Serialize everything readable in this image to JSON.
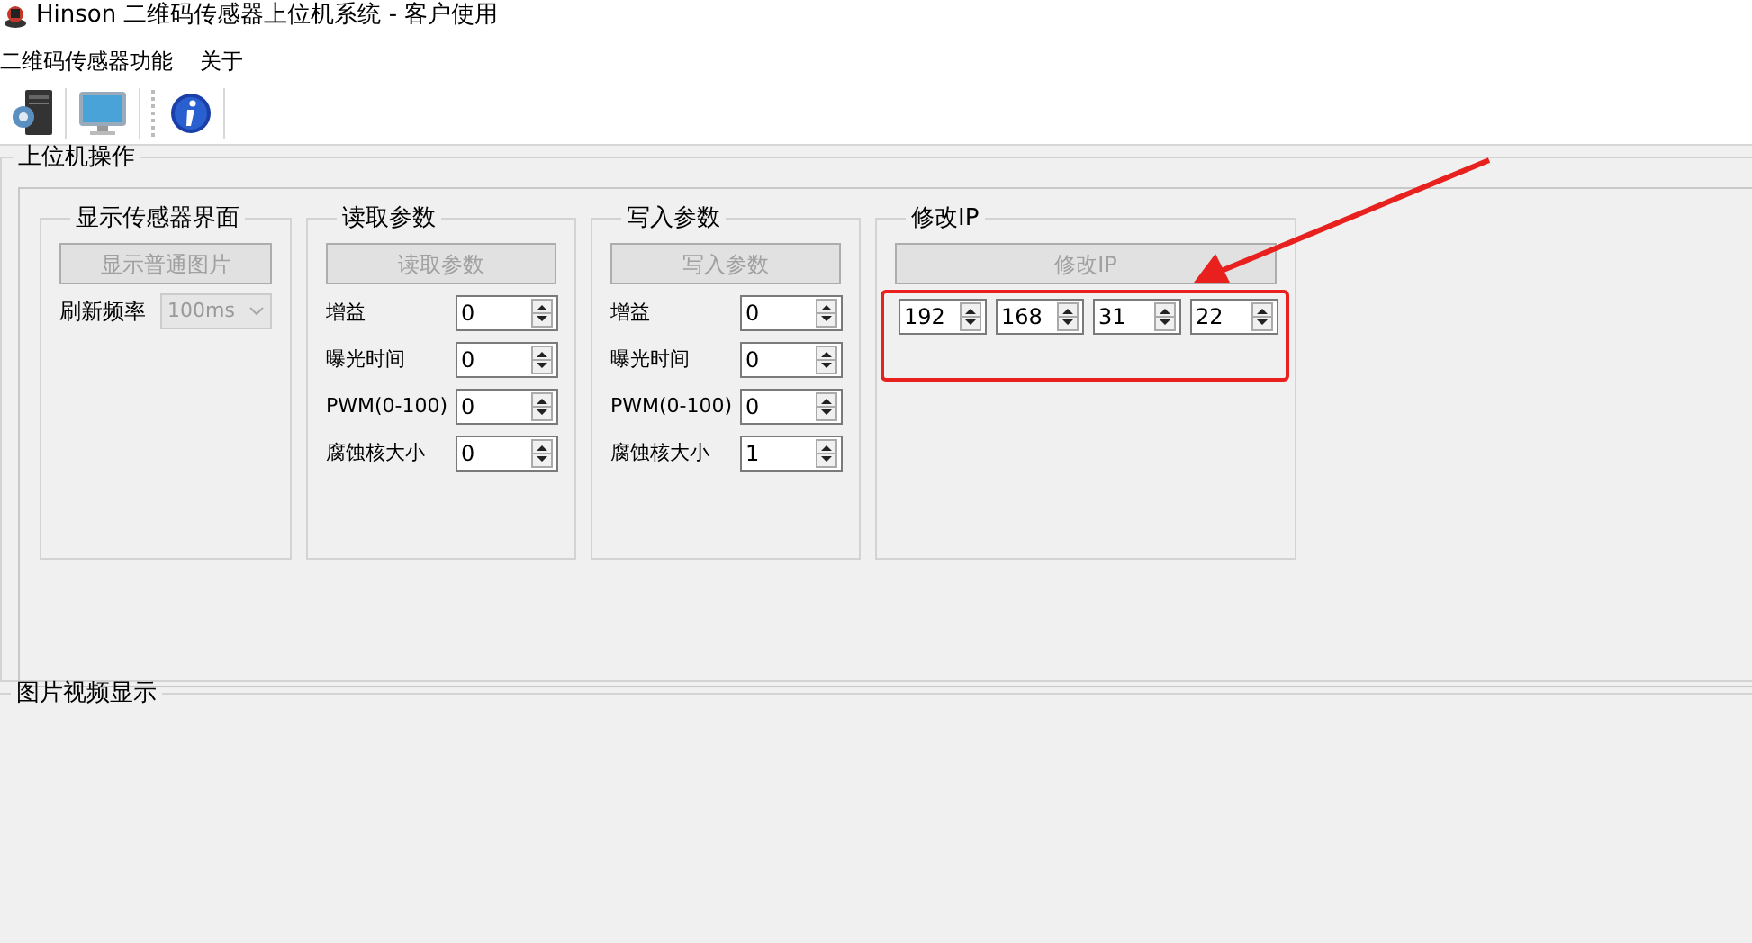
{
  "window": {
    "title": "Hinson 二维码传感器上位机系统 - 客户使用"
  },
  "menu": [
    {
      "label": "二维码传感器功能"
    },
    {
      "label": "关于"
    }
  ],
  "toolbar": [
    {
      "kind": "computer"
    },
    {
      "kind": "monitor"
    },
    {
      "kind": "info"
    }
  ],
  "operation_panel": {
    "title": "上位机操作",
    "groups": [
      {
        "kind": "display",
        "title": "显示传感器界面",
        "button": {
          "label": "显示普通图片",
          "disabled": true
        },
        "refresh": {
          "label": "刷新频率",
          "value": "100ms",
          "disabled": true
        }
      },
      {
        "kind": "params",
        "title": "读取参数",
        "button": {
          "label": "读取参数",
          "disabled": true
        },
        "fields": [
          {
            "label": "增益",
            "value": "0"
          },
          {
            "label": "曝光时间",
            "value": "0"
          },
          {
            "label": "PWM(0-100)",
            "value": "0"
          },
          {
            "label": "腐蚀核大小",
            "value": "0"
          }
        ]
      },
      {
        "kind": "params",
        "title": "写入参数",
        "button": {
          "label": "写入参数",
          "disabled": true
        },
        "fields": [
          {
            "label": "增益",
            "value": "0"
          },
          {
            "label": "曝光时间",
            "value": "0"
          },
          {
            "label": "PWM(0-100)",
            "value": "0"
          },
          {
            "label": "腐蚀核大小",
            "value": "1"
          }
        ]
      },
      {
        "kind": "ip",
        "title": "修改IP",
        "button": {
          "label": "修改IP",
          "disabled": true
        },
        "highlighted": true,
        "fields": [
          {
            "value": "192"
          },
          {
            "value": "168"
          },
          {
            "value": "31"
          },
          {
            "value": "22"
          }
        ]
      }
    ]
  },
  "annotation_arrow": true,
  "video_panel": {
    "title": "图片视频显示"
  }
}
